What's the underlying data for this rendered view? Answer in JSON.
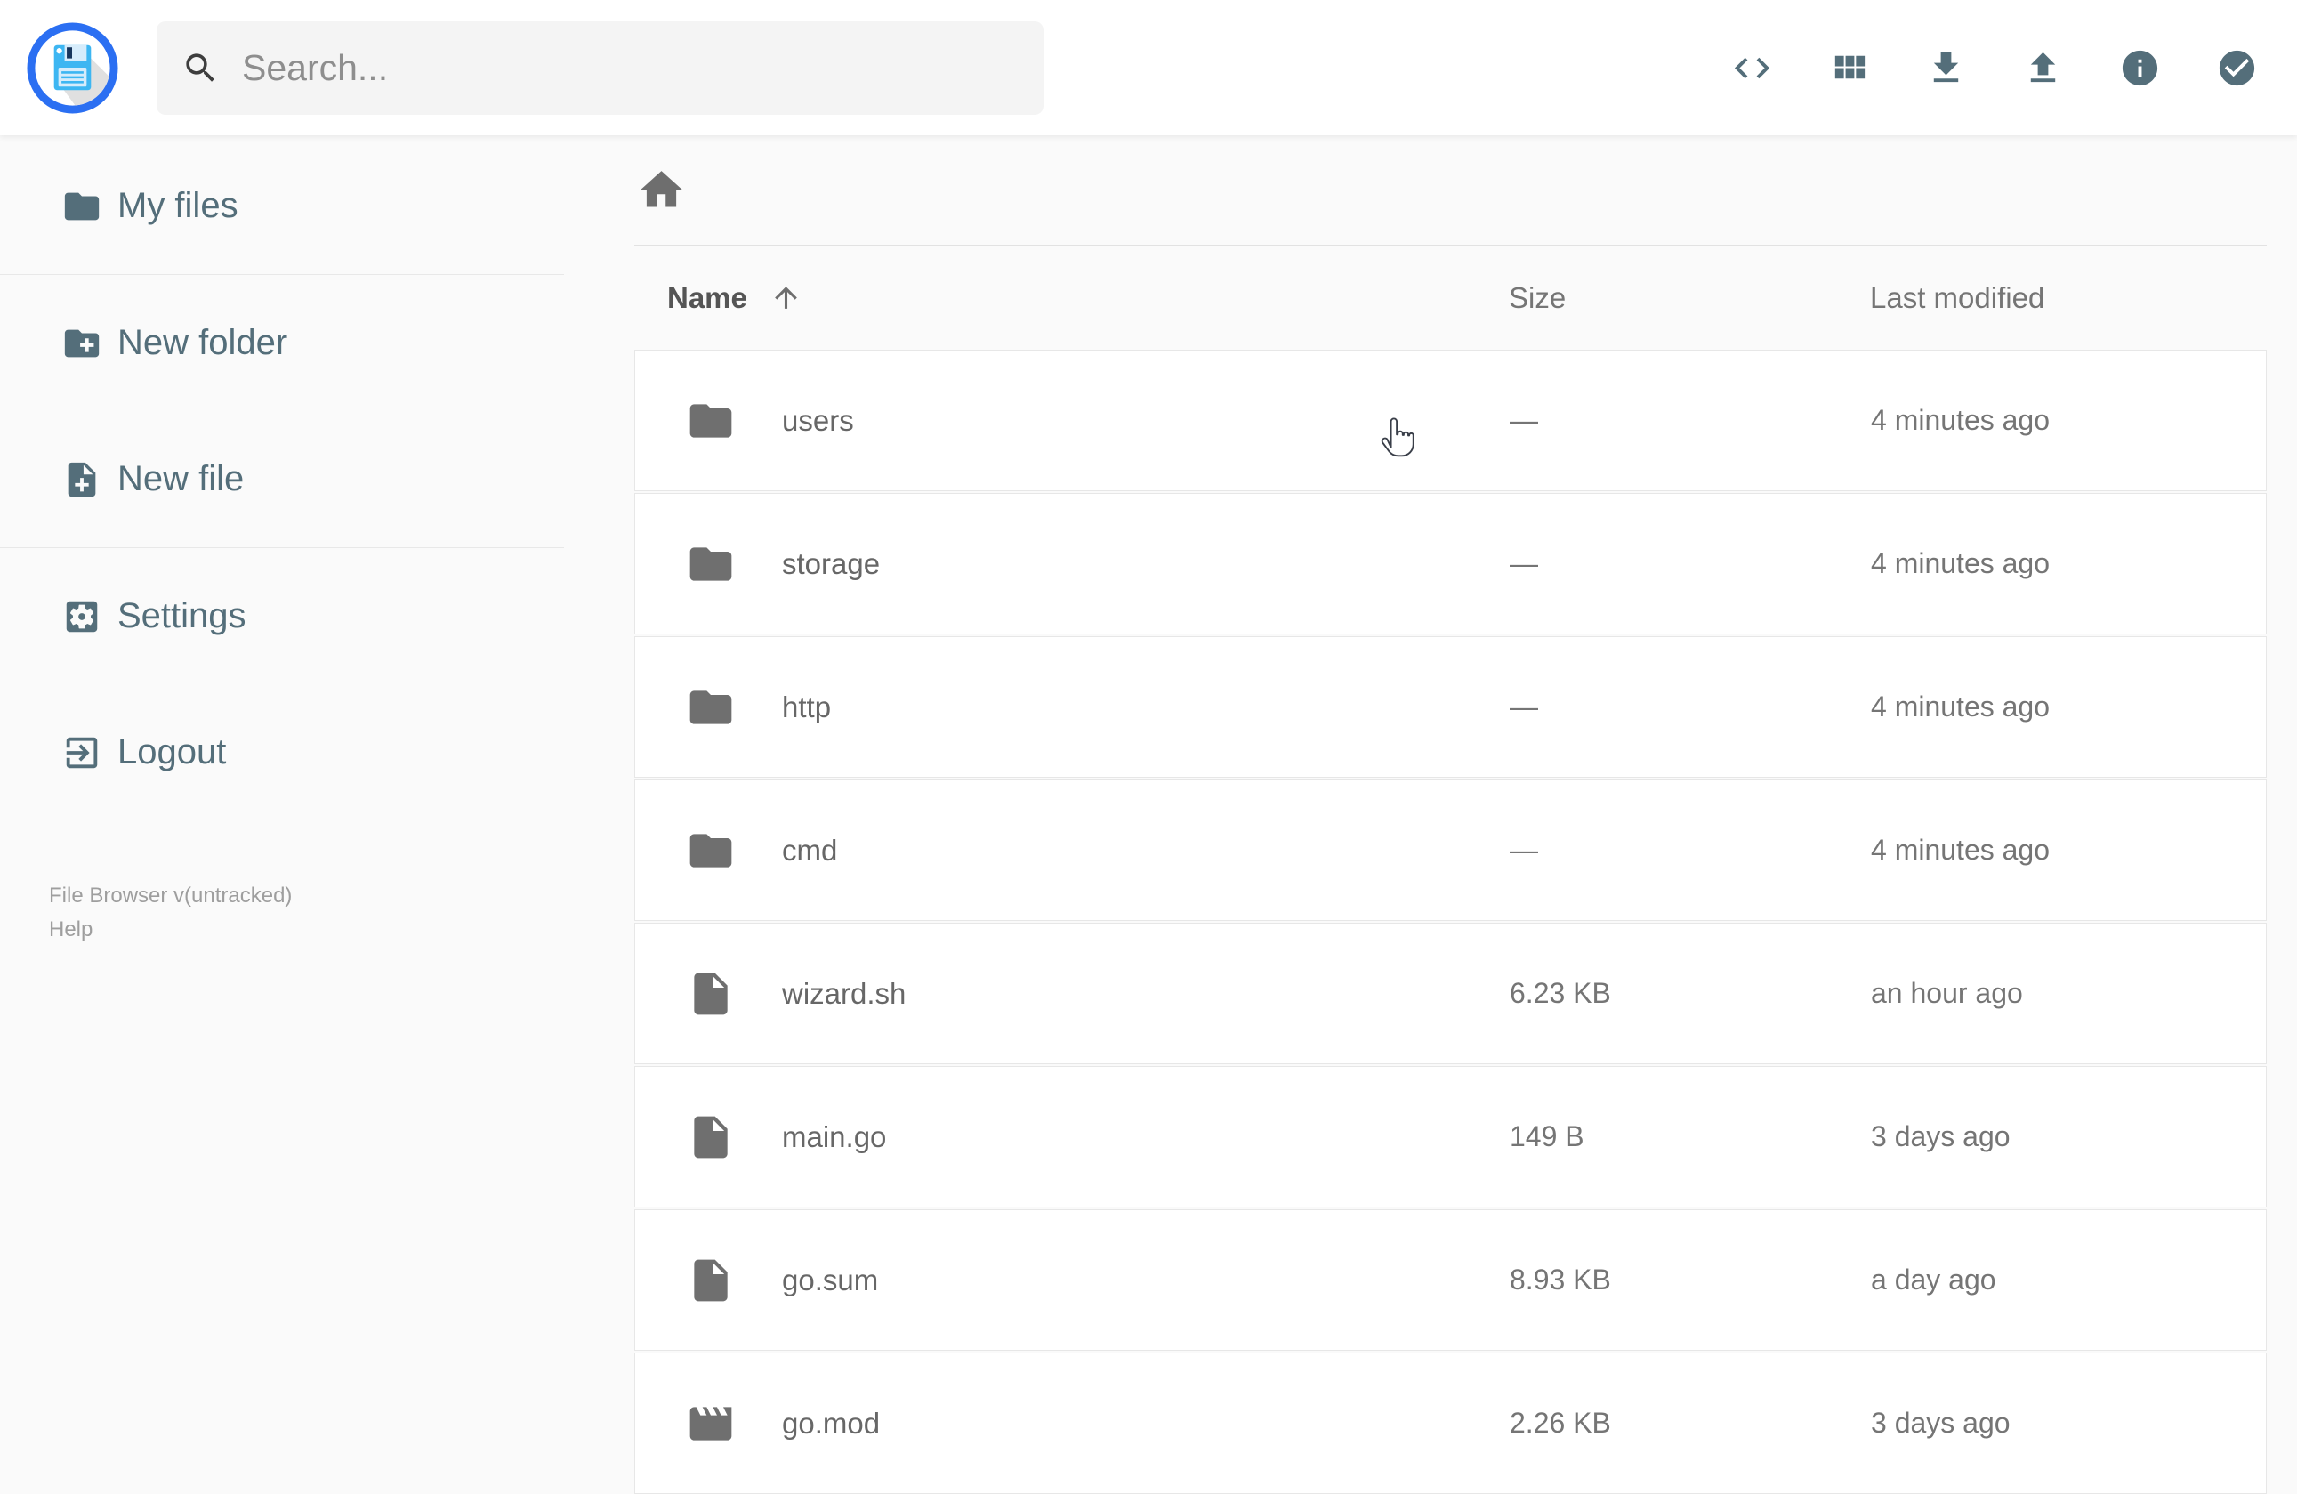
{
  "colors": {
    "accent_blue": "#2b6ff2",
    "logo_floppy_blue": "#3db6f2",
    "slate_icon_text": "#546e7a",
    "row_text_gray": "#676767",
    "muted_gray": "#757575",
    "header_name_gray": "#555555",
    "row_background": "#ffffff",
    "page_background": "#fafafa"
  },
  "header": {
    "logo_icon": "floppy-disk-logo",
    "search": {
      "placeholder": "Search...",
      "icon": "search-icon"
    },
    "toolbar_icons": [
      {
        "name": "code-icon"
      },
      {
        "name": "grid-view-icon"
      },
      {
        "name": "download-icon"
      },
      {
        "name": "upload-icon"
      },
      {
        "name": "info-icon"
      },
      {
        "name": "check-circle-icon"
      }
    ]
  },
  "sidebar": {
    "groups": [
      {
        "items": [
          {
            "icon": "folder-icon",
            "label": "My files"
          }
        ]
      },
      {
        "items": [
          {
            "icon": "new-folder-icon",
            "label": "New folder"
          },
          {
            "icon": "new-file-icon",
            "label": "New file"
          }
        ]
      },
      {
        "items": [
          {
            "icon": "settings-icon",
            "label": "Settings"
          },
          {
            "icon": "logout-icon",
            "label": "Logout"
          }
        ]
      }
    ],
    "footer": {
      "version": "File Browser v(untracked)",
      "help": "Help"
    }
  },
  "breadcrumb": {
    "home_icon": "home-icon"
  },
  "listing": {
    "columns": {
      "name": "Name",
      "size": "Size",
      "modified": "Last modified"
    },
    "sort": {
      "column": "Name",
      "direction": "ascending",
      "icon": "sort-arrow-up-icon"
    },
    "rows": [
      {
        "icon": "folder-icon",
        "type": "folder",
        "name": "users",
        "size": "—",
        "modified": "4 minutes ago"
      },
      {
        "icon": "folder-icon",
        "type": "folder",
        "name": "storage",
        "size": "—",
        "modified": "4 minutes ago"
      },
      {
        "icon": "folder-icon",
        "type": "folder",
        "name": "http",
        "size": "—",
        "modified": "4 minutes ago"
      },
      {
        "icon": "folder-icon",
        "type": "folder",
        "name": "cmd",
        "size": "—",
        "modified": "4 minutes ago"
      },
      {
        "icon": "file-icon",
        "type": "file",
        "name": "wizard.sh",
        "size": "6.23 KB",
        "modified": "an hour ago"
      },
      {
        "icon": "file-icon",
        "type": "file",
        "name": "main.go",
        "size": "149 B",
        "modified": "3 days ago"
      },
      {
        "icon": "file-icon",
        "type": "file",
        "name": "go.sum",
        "size": "8.93 KB",
        "modified": "a day ago"
      },
      {
        "icon": "movie-icon",
        "type": "file",
        "name": "go.mod",
        "size": "2.26 KB",
        "modified": "3 days ago"
      }
    ]
  },
  "cursor": {
    "icon": "hand-pointer-cursor",
    "over": "users row"
  }
}
